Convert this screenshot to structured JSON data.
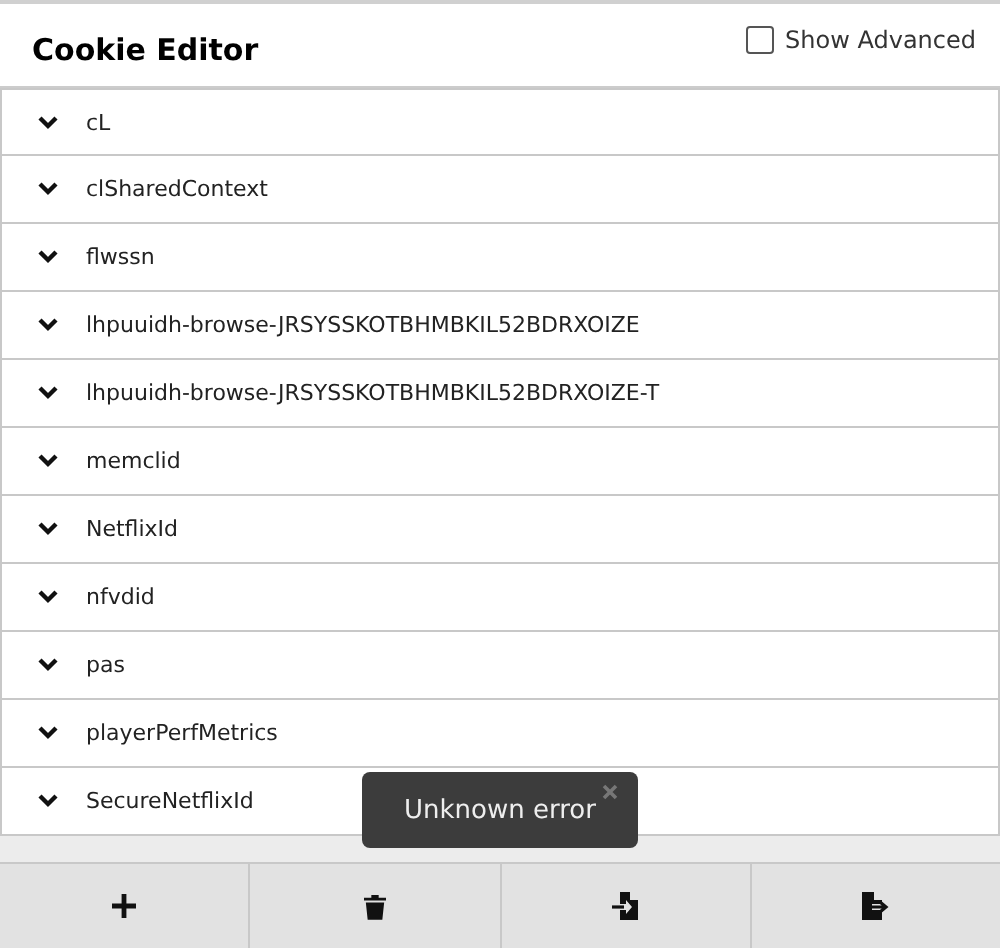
{
  "header": {
    "title": "Cookie Editor",
    "show_advanced": {
      "label": "Show Advanced",
      "checked": false
    }
  },
  "cookies": [
    {
      "name": "cL",
      "expanded": false
    },
    {
      "name": "clSharedContext",
      "expanded": false
    },
    {
      "name": "flwssn",
      "expanded": false
    },
    {
      "name": "lhpuuidh-browse-JRSYSSKOTBHMBKIL52BDRXOIZE",
      "expanded": false
    },
    {
      "name": "lhpuuidh-browse-JRSYSSKOTBHMBKIL52BDRXOIZE-T",
      "expanded": false
    },
    {
      "name": "memclid",
      "expanded": false
    },
    {
      "name": "NetflixId",
      "expanded": false
    },
    {
      "name": "nfvdid",
      "expanded": false
    },
    {
      "name": "pas",
      "expanded": false
    },
    {
      "name": "playerPerfMetrics",
      "expanded": false
    },
    {
      "name": "SecureNetflixId",
      "expanded": false
    }
  ],
  "toast": {
    "message": "Unknown error"
  },
  "toolbar": [
    {
      "kind": "add"
    },
    {
      "kind": "delete"
    },
    {
      "kind": "import"
    },
    {
      "kind": "export"
    }
  ]
}
